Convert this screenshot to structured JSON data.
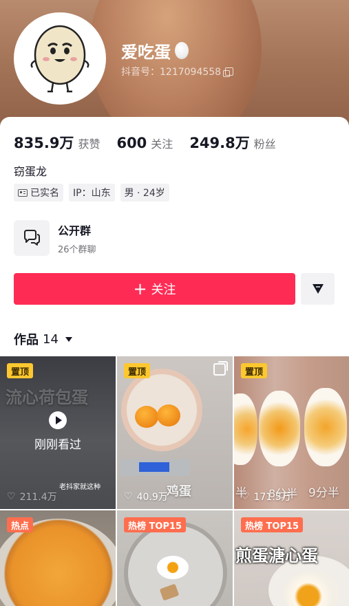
{
  "profile": {
    "name": "爱吃蛋",
    "douyin_id": "抖音号：1217094558"
  },
  "stats": [
    {
      "value": "835.9万",
      "label": "获赞"
    },
    {
      "value": "600",
      "label": "关注"
    },
    {
      "value": "249.8万",
      "label": "粉丝"
    }
  ],
  "bio": "窃蛋龙",
  "tags": [
    "已实名",
    "IP：山东",
    "男 · 24岁"
  ],
  "group": {
    "title": "公开群",
    "subtitle": "26个群聊"
  },
  "actions": {
    "follow_label": "关注"
  },
  "works_tab": {
    "label": "作品",
    "count": "14"
  },
  "videos": [
    {
      "badge": "置顶",
      "likes": "211.4万",
      "overlay": "流心荷包蛋",
      "viewed": "刚刚看过",
      "caption": "老抖家就这种"
    },
    {
      "badge": "置顶",
      "likes": "40.9万",
      "overlay": "鸡蛋"
    },
    {
      "badge": "置顶",
      "likes": "171.5万",
      "overlay_a": "8分半",
      "overlay_b": "9分半",
      "overlay_c": "半"
    },
    {
      "badge": "热点",
      "likes": ""
    },
    {
      "badge": "热榜 TOP15",
      "likes": ""
    },
    {
      "badge": "热榜 TOP15",
      "likes": "",
      "overlay": "煎蛋溏心蛋"
    }
  ],
  "colors": {
    "accent": "#fe2c55",
    "pin_badge": "#fdc72f",
    "hot_badge": "#fe6e4e"
  }
}
